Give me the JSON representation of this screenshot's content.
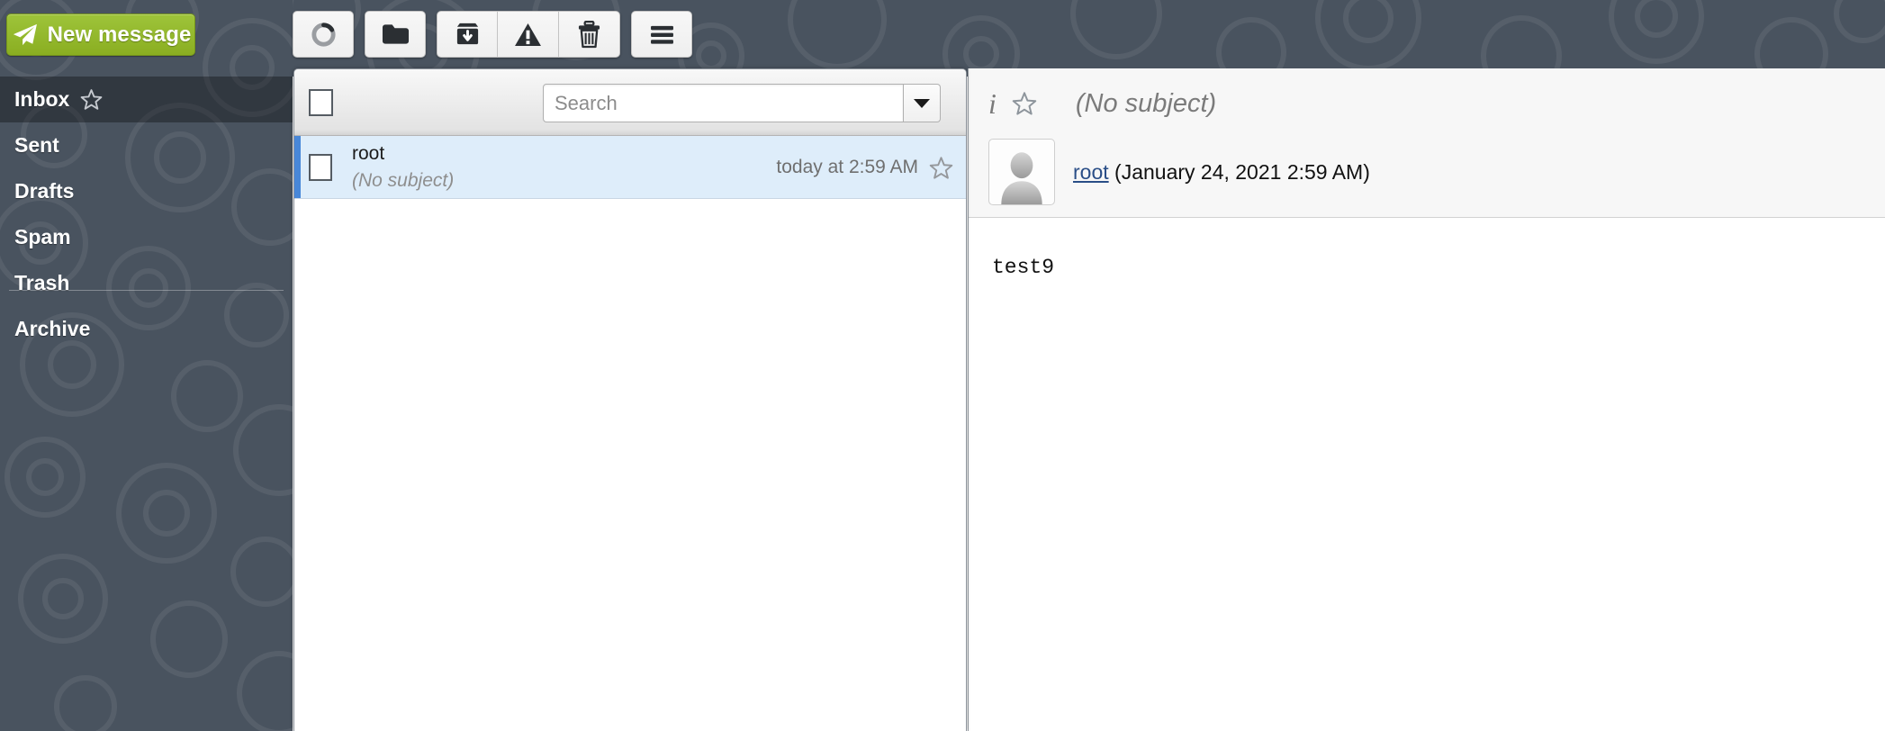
{
  "colors": {
    "sidebar_bg": "#49535f",
    "sidebar_selected": "#2d3036",
    "new_message_green": "#8cb225",
    "selected_row_bg": "#deedfa",
    "selected_row_bar": "#4887d8",
    "link_blue": "#2a4e87"
  },
  "compose": {
    "label": "New message",
    "icon": "paper-plane-icon"
  },
  "toolbar": {
    "buttons": [
      {
        "name": "refresh-button",
        "icon": "refresh-circle-icon",
        "label": "Refresh"
      },
      {
        "name": "folder-button",
        "icon": "folder-icon",
        "label": "Move to folder"
      },
      {
        "name": "archive-button",
        "icon": "archive-down-icon",
        "label": "Archive"
      },
      {
        "name": "junk-button",
        "icon": "warning-triangle-icon",
        "label": "Mark as junk"
      },
      {
        "name": "delete-button",
        "icon": "trash-icon",
        "label": "Delete"
      },
      {
        "name": "menu-button",
        "icon": "hamburger-menu-icon",
        "label": "More"
      }
    ]
  },
  "sidebar": {
    "items": [
      {
        "label": "Inbox",
        "selected": true,
        "has_star": true
      },
      {
        "label": "Sent",
        "selected": false,
        "has_star": false
      },
      {
        "label": "Drafts",
        "selected": false,
        "has_star": false
      },
      {
        "label": "Spam",
        "selected": false,
        "has_star": false
      },
      {
        "label": "Trash",
        "selected": false,
        "has_star": false
      },
      {
        "label": "Archive",
        "selected": false,
        "has_star": false
      }
    ]
  },
  "message_list": {
    "select_all_checked": false,
    "search": {
      "value": "",
      "placeholder": "Search"
    },
    "rows": [
      {
        "from": "root",
        "subject": "(No subject)",
        "date": "today at 2:59 AM",
        "selected": true,
        "checked": false,
        "flagged": false
      }
    ]
  },
  "reading_pane": {
    "subject": "(No subject)",
    "sender_name": "root",
    "sender_date": "(January 24, 2021 2:59 AM)",
    "body": "test9",
    "flagged": false
  }
}
